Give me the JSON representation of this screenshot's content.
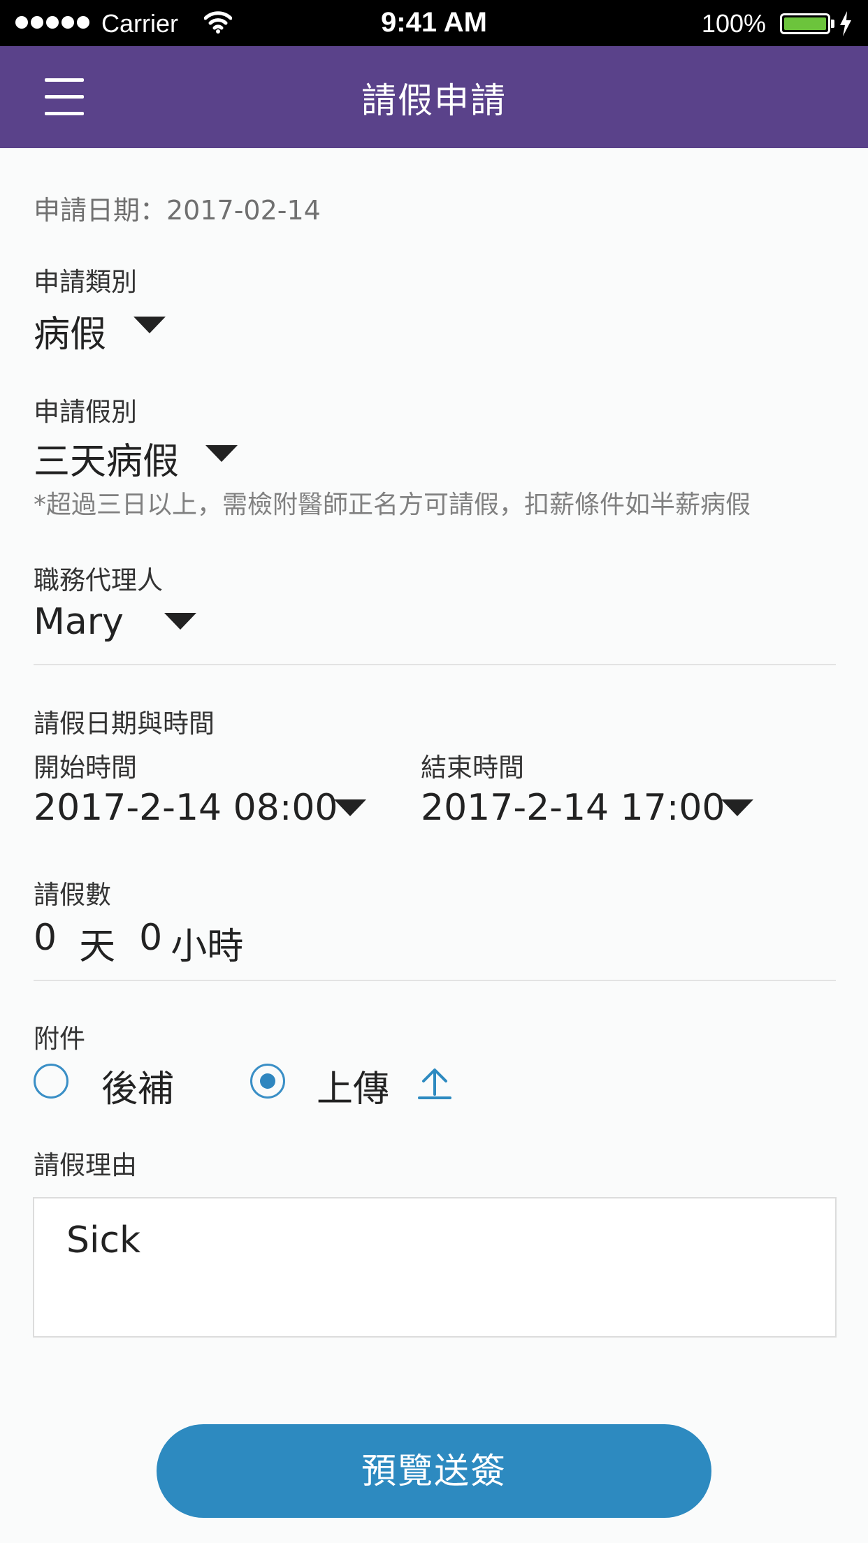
{
  "status_bar": {
    "carrier": "Carrier",
    "time": "9:41 AM",
    "battery": "100%",
    "battery_level": 1.0,
    "signal_dots": 5,
    "icons": [
      "signal-icon",
      "wifi-icon",
      "battery-icon",
      "charging-bolt-icon"
    ]
  },
  "header": {
    "title": "請假申請",
    "menu_icon": "hamburger-menu-icon",
    "background": "#5a428a"
  },
  "form": {
    "apply_date": "申請日期：2017-02-14",
    "category": {
      "label": "申請類別",
      "value": "病假"
    },
    "leave_type": {
      "label": "申請假別",
      "value": "三天病假",
      "note": "*超過三日以上，需檢附醫師正名方可請假，扣薪條件如半薪病假"
    },
    "deputy": {
      "label": "職務代理人",
      "value": "Mary"
    },
    "period": {
      "label": "請假日期與時間",
      "start_label": "開始時間",
      "start_value": "2017-2-14 08:00",
      "end_label": "結束時間",
      "end_value": "2017-2-14 17:00"
    },
    "count": {
      "label": "請假數",
      "days": "0",
      "days_unit": "天",
      "hours": "0",
      "hours_unit": "小時"
    },
    "attachment": {
      "label": "附件",
      "option_later": "後補",
      "option_upload": "上傳",
      "selected": "上傳",
      "upload_icon": "upload-icon"
    },
    "reason": {
      "label": "請假理由",
      "value": "Sick"
    }
  },
  "submit": {
    "label": "預覽送簽",
    "color": "#2d8ac0"
  },
  "colors": {
    "accent": "#2d8ac0",
    "header": "#5a428a",
    "note": "#808080"
  }
}
